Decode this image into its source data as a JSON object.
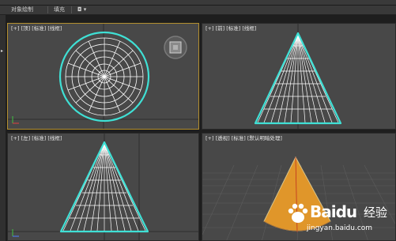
{
  "ribbon": {
    "tabs": [
      "对象绘制",
      "填充"
    ]
  },
  "viewports": {
    "top": {
      "label": "[+] [顶] [标准] [线框]"
    },
    "front": {
      "label": "[+] [前] [标准] [线框]"
    },
    "left": {
      "label": "[+] [左] [标准] [线框]"
    },
    "perspective": {
      "label": "[+] [透视] [标准] [默认明暗处理]"
    }
  },
  "watermark": {
    "brand": "Baidu",
    "suffix": "经验",
    "url": "jingyan.baidu.com"
  },
  "colors": {
    "viewport_bg": "#484848",
    "active_border": "#b38f2f",
    "wire_outline": "#3fe0d5",
    "cone_orange": "#e0962a"
  },
  "icons": [
    "viewcube-icon",
    "axis-gizmo-icon",
    "panel-arrow-icon"
  ]
}
